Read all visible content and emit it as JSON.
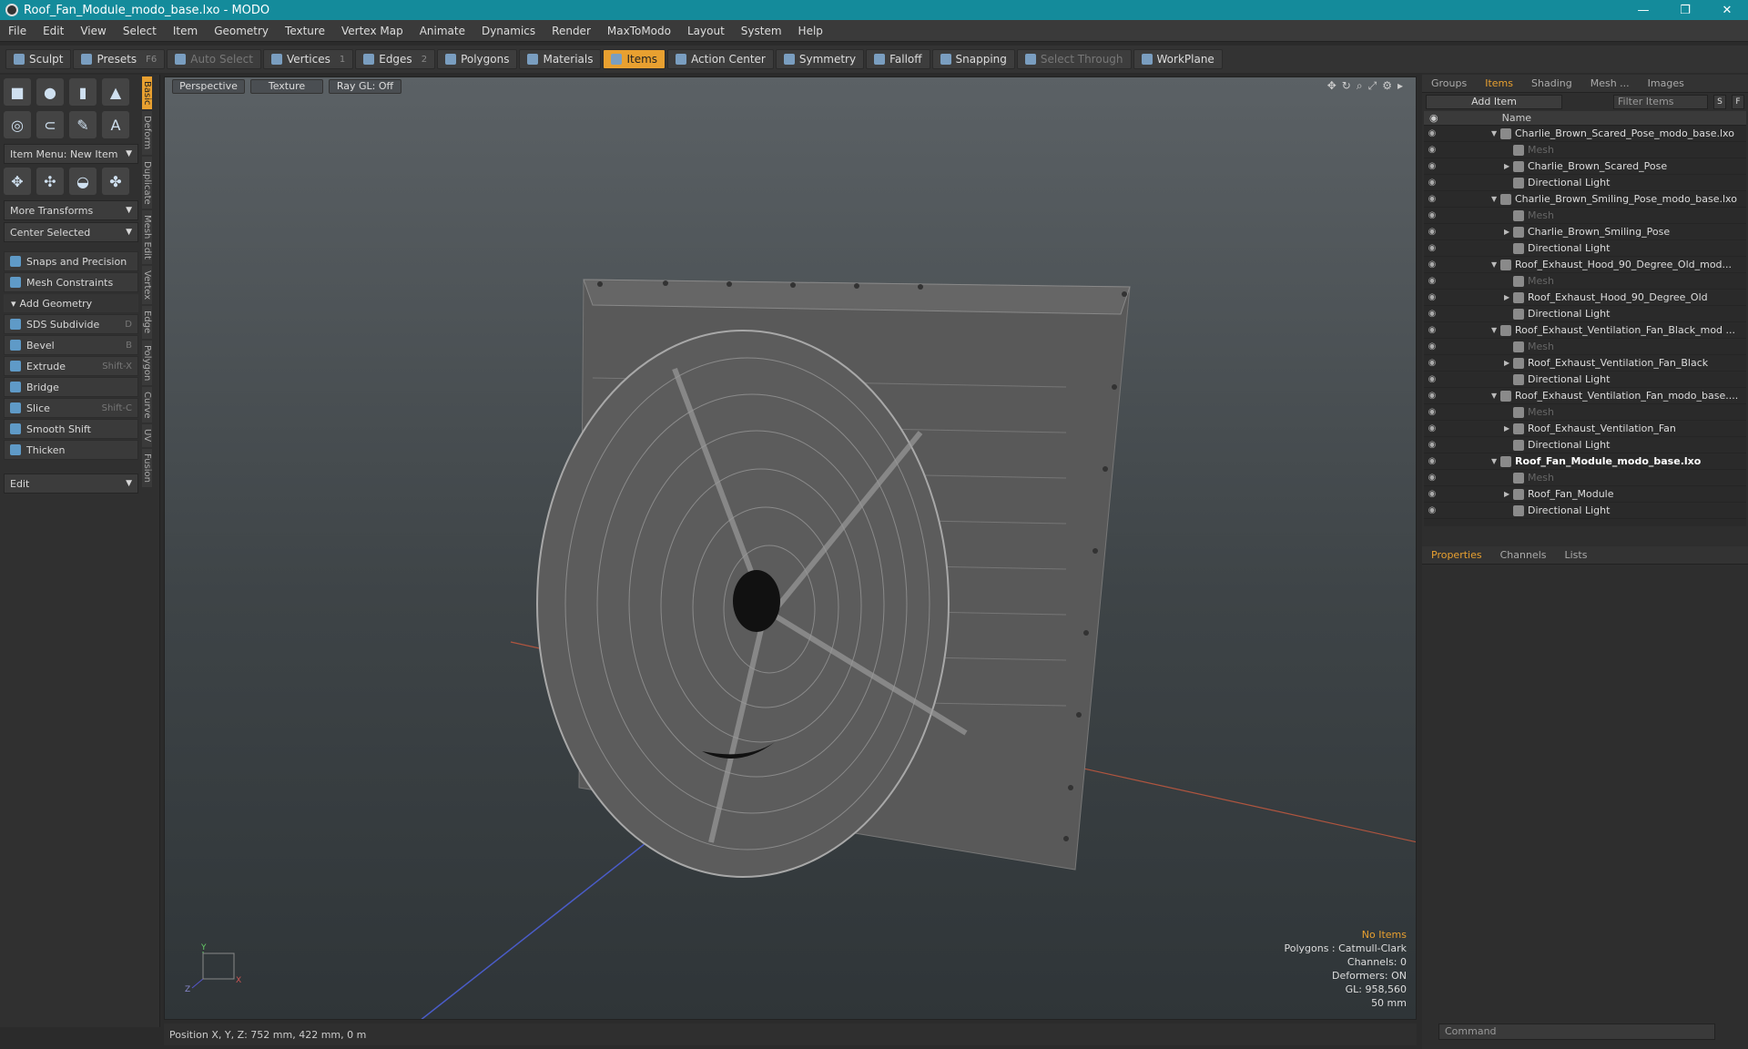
{
  "window": {
    "title": "Roof_Fan_Module_modo_base.lxo - MODO",
    "controls": [
      "—",
      "❐",
      "✕"
    ]
  },
  "menu": [
    "File",
    "Edit",
    "View",
    "Select",
    "Item",
    "Geometry",
    "Texture",
    "Vertex Map",
    "Animate",
    "Dynamics",
    "Render",
    "MaxToModo",
    "Layout",
    "System",
    "Help"
  ],
  "toolbar": {
    "sculpt": "Sculpt",
    "presets": "Presets",
    "presets_key": "F6",
    "auto_select": "Auto Select",
    "vertices": "Vertices",
    "vertices_num": "1",
    "edges": "Edges",
    "edges_num": "2",
    "polygons": "Polygons",
    "materials": "Materials",
    "items": "Items",
    "action_center": "Action Center",
    "symmetry": "Symmetry",
    "falloff": "Falloff",
    "snapping": "Snapping",
    "select_through": "Select Through",
    "workplane": "WorkPlane"
  },
  "left": {
    "item_menu": "Item Menu: New Item",
    "more_transforms": "More Transforms",
    "center_selected": "Center Selected",
    "snaps": "Snaps and Precision",
    "mesh_constraints": "Mesh Constraints",
    "add_geometry": "Add Geometry",
    "tools": [
      {
        "label": "SDS Subdivide",
        "key": "D"
      },
      {
        "label": "Bevel",
        "key": "B"
      },
      {
        "label": "Extrude",
        "key": "Shift-X"
      },
      {
        "label": "Bridge",
        "key": ""
      },
      {
        "label": "Slice",
        "key": "Shift-C"
      },
      {
        "label": "Smooth Shift",
        "key": ""
      },
      {
        "label": "Thicken",
        "key": ""
      }
    ],
    "edit": "Edit",
    "vtabs": [
      "Basic",
      "Deform",
      "Duplicate",
      "Mesh Edit",
      "Vertex",
      "Edge",
      "Polygon",
      "Curve",
      "UV",
      "Fusion"
    ]
  },
  "viewport": {
    "perspective": "Perspective",
    "texture": "Texture",
    "raygl": "Ray GL: Off",
    "stats": {
      "no_items": "No Items",
      "polygons": "Polygons : Catmull-Clark",
      "channels": "Channels: 0",
      "deformers": "Deformers: ON",
      "gl": "GL: 958,560",
      "mm": "50 mm"
    },
    "axis": {
      "y": "Y",
      "x": "X",
      "z": "Z"
    }
  },
  "status": {
    "position": "Position X, Y, Z:  752 mm, 422 mm, 0 m"
  },
  "right": {
    "tabs": [
      "Groups",
      "Items",
      "Shading",
      "Mesh ...",
      "Images"
    ],
    "add_item": "Add Item",
    "filter": "Filter Items",
    "s": "S",
    "f": "F",
    "col_name": "Name",
    "tree": [
      {
        "label": "Charlie_Brown_Scared_Pose_modo_base.lxo",
        "type": "scene"
      },
      {
        "label": "Mesh",
        "type": "mesh"
      },
      {
        "label": "Charlie_Brown_Scared_Pose",
        "type": "group"
      },
      {
        "label": "Directional Light",
        "type": "light"
      },
      {
        "label": "Charlie_Brown_Smiling_Pose_modo_base.lxo",
        "type": "scene"
      },
      {
        "label": "Mesh",
        "type": "mesh"
      },
      {
        "label": "Charlie_Brown_Smiling_Pose",
        "type": "group"
      },
      {
        "label": "Directional Light",
        "type": "light"
      },
      {
        "label": "Roof_Exhaust_Hood_90_Degree_Old_mod...",
        "type": "scene"
      },
      {
        "label": "Mesh",
        "type": "mesh"
      },
      {
        "label": "Roof_Exhaust_Hood_90_Degree_Old",
        "type": "group"
      },
      {
        "label": "Directional Light",
        "type": "light"
      },
      {
        "label": "Roof_Exhaust_Ventilation_Fan_Black_mod ...",
        "type": "scene"
      },
      {
        "label": "Mesh",
        "type": "mesh"
      },
      {
        "label": "Roof_Exhaust_Ventilation_Fan_Black",
        "type": "group"
      },
      {
        "label": "Directional Light",
        "type": "light"
      },
      {
        "label": "Roof_Exhaust_Ventilation_Fan_modo_base....",
        "type": "scene"
      },
      {
        "label": "Mesh",
        "type": "mesh"
      },
      {
        "label": "Roof_Exhaust_Ventilation_Fan",
        "type": "group"
      },
      {
        "label": "Directional Light",
        "type": "light"
      },
      {
        "label": "Roof_Fan_Module_modo_base.lxo",
        "type": "scene-bold"
      },
      {
        "label": "Mesh",
        "type": "mesh"
      },
      {
        "label": "Roof_Fan_Module",
        "type": "group"
      },
      {
        "label": "Directional Light",
        "type": "light"
      }
    ],
    "ptabs": [
      "Properties",
      "Channels",
      "Lists"
    ],
    "command": "Command"
  },
  "colors": {
    "accent": "#e8a030",
    "title": "#148b9b"
  }
}
